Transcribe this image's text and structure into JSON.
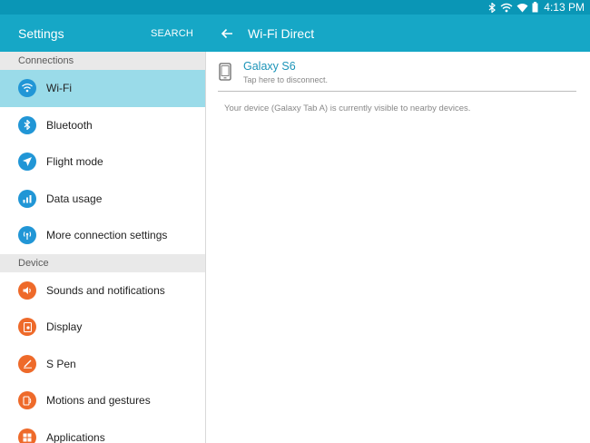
{
  "status_bar": {
    "time": "4:13 PM",
    "icons": [
      "bluetooth-icon",
      "wifi-direct-icon",
      "wifi-icon",
      "battery-icon"
    ]
  },
  "left_header": {
    "title": "Settings",
    "search_label": "SEARCH"
  },
  "right_header": {
    "back_icon": "back-arrow-icon",
    "title": "Wi-Fi Direct"
  },
  "sidebar": {
    "sections": [
      {
        "header": "Connections",
        "items": [
          {
            "label": "Wi-Fi",
            "icon": "wifi-icon",
            "color": "#2196d6",
            "selected": true
          },
          {
            "label": "Bluetooth",
            "icon": "bluetooth-icon",
            "color": "#2196d6"
          },
          {
            "label": "Flight mode",
            "icon": "airplane-icon",
            "color": "#2196d6"
          },
          {
            "label": "Data usage",
            "icon": "data-usage-icon",
            "color": "#2196d6"
          },
          {
            "label": "More connection settings",
            "icon": "antenna-icon",
            "color": "#2196d6"
          }
        ]
      },
      {
        "header": "Device",
        "items": [
          {
            "label": "Sounds and notifications",
            "icon": "speaker-icon",
            "color": "#ee6a2a"
          },
          {
            "label": "Display",
            "icon": "display-icon",
            "color": "#ee6a2a"
          },
          {
            "label": "S Pen",
            "icon": "pen-icon",
            "color": "#ee6a2a"
          },
          {
            "label": "Motions and gestures",
            "icon": "gesture-icon",
            "color": "#ee6a2a"
          },
          {
            "label": "Applications",
            "icon": "apps-icon",
            "color": "#ee6a2a"
          }
        ]
      }
    ]
  },
  "main": {
    "device": {
      "name": "Galaxy S6",
      "subtitle": "Tap here to disconnect.",
      "icon": "phone-icon"
    },
    "visibility_note": "Your device (Galaxy Tab A) is currently visible to nearby devices."
  },
  "colors": {
    "status_bar": "#0a96b6",
    "app_bar": "#16a7c6",
    "selected_item": "#9adbe9",
    "connections_icon": "#2196d6",
    "device_icon": "#ee6a2a",
    "device_name": "#1b94b8"
  }
}
